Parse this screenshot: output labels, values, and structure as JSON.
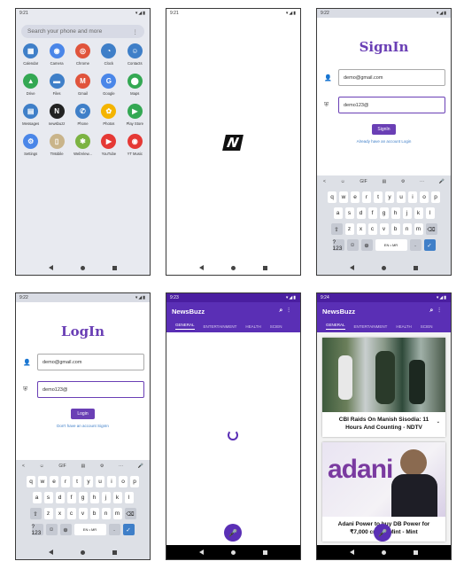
{
  "screen1": {
    "time": "9:21",
    "search_placeholder": "Search your phone and more",
    "apps": [
      {
        "label": "Calendar",
        "icon": "calendar-icon",
        "glyph": "▦",
        "color": "#3f7fc8"
      },
      {
        "label": "Camera",
        "icon": "camera-icon",
        "glyph": "◉",
        "color": "#4a86e8"
      },
      {
        "label": "Chrome",
        "icon": "chrome-icon",
        "glyph": "◎",
        "color": "#e0543c"
      },
      {
        "label": "Clock",
        "icon": "clock-icon",
        "glyph": "◔",
        "color": "#3f7fc8"
      },
      {
        "label": "Contacts",
        "icon": "contacts-icon",
        "glyph": "☺",
        "color": "#3f7fc8"
      },
      {
        "label": "Drive",
        "icon": "drive-icon",
        "glyph": "▲",
        "color": "#34a853"
      },
      {
        "label": "Files",
        "icon": "files-icon",
        "glyph": "▬",
        "color": "#3f7fc8"
      },
      {
        "label": "Gmail",
        "icon": "gmail-icon",
        "glyph": "M",
        "color": "#e0543c"
      },
      {
        "label": "Google",
        "icon": "google-icon",
        "glyph": "G",
        "color": "#4a86e8"
      },
      {
        "label": "Maps",
        "icon": "maps-icon",
        "glyph": "⬤",
        "color": "#34a853"
      },
      {
        "label": "Messages",
        "icon": "messages-icon",
        "glyph": "▤",
        "color": "#3f7fc8"
      },
      {
        "label": "newsbuzz",
        "icon": "newsbuzz-icon",
        "glyph": "N",
        "color": "#222222"
      },
      {
        "label": "Phone",
        "icon": "phone-icon",
        "glyph": "✆",
        "color": "#3f7fc8"
      },
      {
        "label": "Photos",
        "icon": "photos-icon",
        "glyph": "✿",
        "color": "#f4b400"
      },
      {
        "label": "Play Store",
        "icon": "play-store-icon",
        "glyph": "▶",
        "color": "#34a853"
      },
      {
        "label": "Settings",
        "icon": "settings-icon",
        "glyph": "⚙",
        "color": "#4a86e8"
      },
      {
        "label": "TMobile",
        "icon": "tmobile-icon",
        "glyph": "▯",
        "color": "#c9b48a"
      },
      {
        "label": "WebView...",
        "icon": "webview-icon",
        "glyph": "✱",
        "color": "#7cb342"
      },
      {
        "label": "YouTube",
        "icon": "youtube-icon",
        "glyph": "▶",
        "color": "#e53935"
      },
      {
        "label": "YT Music",
        "icon": "yt-music-icon",
        "glyph": "◉",
        "color": "#e53935"
      }
    ]
  },
  "screen2": {
    "time": "9:21",
    "logo": "N"
  },
  "screen3": {
    "time": "9:22",
    "title": "SignIn",
    "email": "demo@gmail.com",
    "password": "demo123@",
    "button": "SignIn",
    "link": "Already have an account Login"
  },
  "screen4": {
    "time": "9:22",
    "title": "LogIn",
    "email": "demo@gmail.com",
    "password": "demo123@",
    "button": "Login",
    "link": "Don't have an account SignIn"
  },
  "keyboard": {
    "tools": [
      "<",
      "☺",
      "GIF",
      "▤",
      "⚙",
      "···",
      "🎤"
    ],
    "row1": [
      "q",
      "w",
      "e",
      "r",
      "t",
      "y",
      "u",
      "i",
      "o",
      "p"
    ],
    "row2": [
      "a",
      "s",
      "d",
      "f",
      "g",
      "h",
      "j",
      "k",
      "l"
    ],
    "row3": [
      "⇧",
      "z",
      "x",
      "c",
      "v",
      "b",
      "n",
      "m",
      "⌫"
    ],
    "row4": [
      "?123",
      "☺",
      "⊕",
      "EN • MR",
      ".",
      "✓"
    ]
  },
  "screen5": {
    "time": "9:23",
    "app_title": "NewsBuzz",
    "tabs": [
      "GENERAL",
      "ENTERTAINMENT",
      "HEALTH",
      "SCIEN"
    ]
  },
  "screen6": {
    "time": "9:24",
    "app_title": "NewsBuzz",
    "tabs": [
      "GENERAL",
      "ENTERTAINMENT",
      "HEALTH",
      "SCIEN"
    ],
    "articles": [
      {
        "headline": "CBI Raids On Manish Sisodia: 11 Hours And Counting - NDTV"
      },
      {
        "headline": "Adani Power to buy DB Power for ₹7,000 crore | Mint - Mint"
      }
    ],
    "image2_text": "adani"
  }
}
